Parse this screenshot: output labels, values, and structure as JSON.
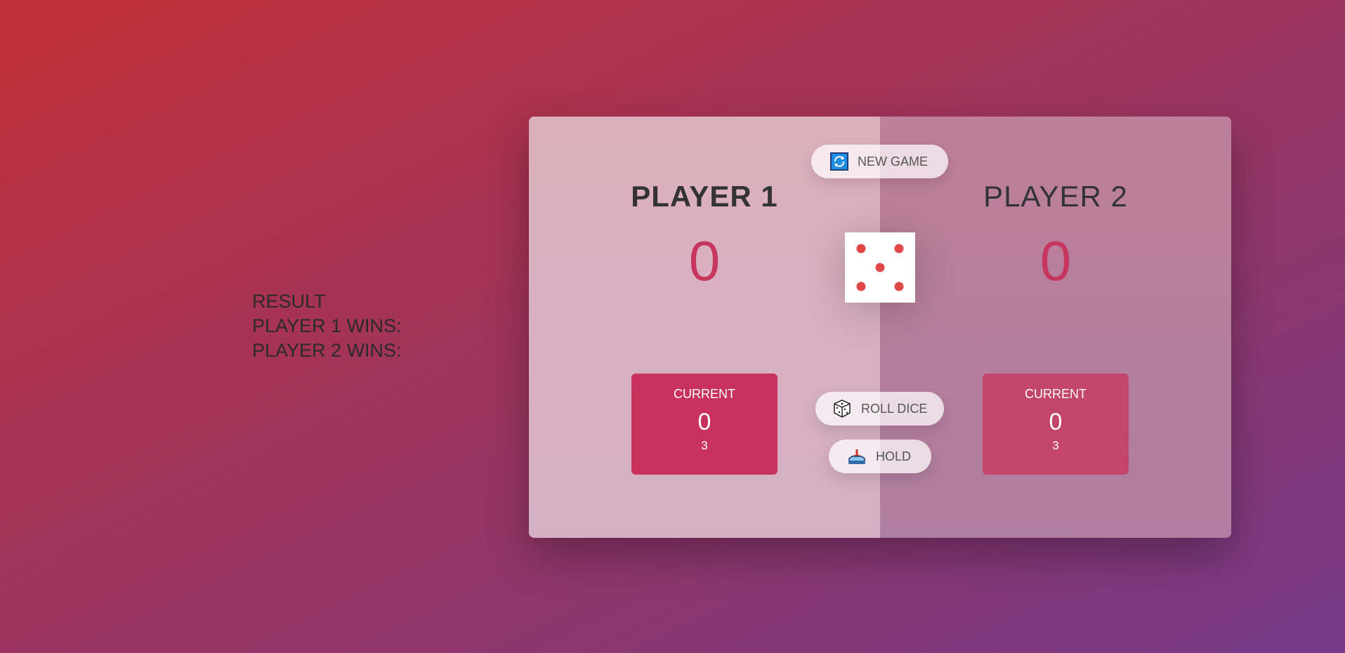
{
  "result": {
    "title": "RESULT",
    "player1_wins_label": "PLAYER 1 WINS:",
    "player2_wins_label": "PLAYER 2 WINS:"
  },
  "players": [
    {
      "name": "PLAYER 1",
      "score": "0",
      "current_label": "CURRENT",
      "current_score": "0",
      "current_sub": "3",
      "active": true
    },
    {
      "name": "PLAYER 2",
      "score": "0",
      "current_label": "CURRENT",
      "current_score": "0",
      "current_sub": "3",
      "active": false
    }
  ],
  "buttons": {
    "new_game": {
      "label": "NEW GAME",
      "icon": "refresh-icon"
    },
    "roll_dice": {
      "label": "ROLL DICE",
      "icon": "dice-icon"
    },
    "hold": {
      "label": "HOLD",
      "icon": "hold-icon"
    }
  },
  "dice": {
    "value": 5,
    "pip_color": "#e04848"
  },
  "colors": {
    "accent": "#c7365f",
    "current_box": "#c7335c"
  }
}
